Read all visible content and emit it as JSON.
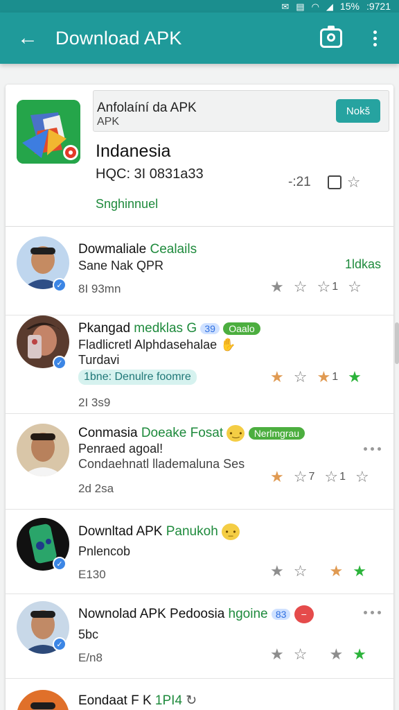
{
  "status_bar": {
    "battery": "15%",
    "time": ":9721"
  },
  "app_bar": {
    "title": "Download APK"
  },
  "header": {
    "banner_line1": "Anfolaíní da APK",
    "banner_line2": "APK",
    "banner_button": "Nokš",
    "app_name": "Indanesia",
    "app_code": "HQC: 3I 0831a33",
    "developer": "Snghinnuel",
    "count": "-:21"
  },
  "rows": [
    {
      "title": "Dowmaliale",
      "title_highlight": "Cealails",
      "line2": "Sane Nak QPR",
      "right_label": "1ldkas",
      "meta": "8I 93mn",
      "count": "1"
    },
    {
      "title": "Pkangad",
      "title_highlight": "medklas G",
      "pill_blue": "39",
      "pill_green": "Oaalo",
      "line2": "Fladlicretl Alphdasehalae",
      "line3": "Turdavi",
      "teal_pill": "1bne: Denulre foomre",
      "meta": "2I 3s9",
      "count": "1"
    },
    {
      "title": "Conmasia",
      "title_highlight": "Doeake Fosat",
      "pill_green": "Nerlmgrau",
      "line2": "Penraed agoal!",
      "line3": "Condaehnatl llademaluna Ses",
      "meta": "2d 2sa",
      "count": "1",
      "star2_count": "7"
    },
    {
      "title": "Downltad APK",
      "title_highlight": "Panukoh",
      "line2": "Pnlencob",
      "meta": "E130"
    },
    {
      "title": "Nownolad APK Pedoosia",
      "title_highlight": "hgoine",
      "pill_blue": "83",
      "line2": "5bc",
      "meta": "E/n8"
    },
    {
      "title": "Eondaat",
      "title_rest": "F K",
      "title_highlight": "1PI4"
    }
  ]
}
